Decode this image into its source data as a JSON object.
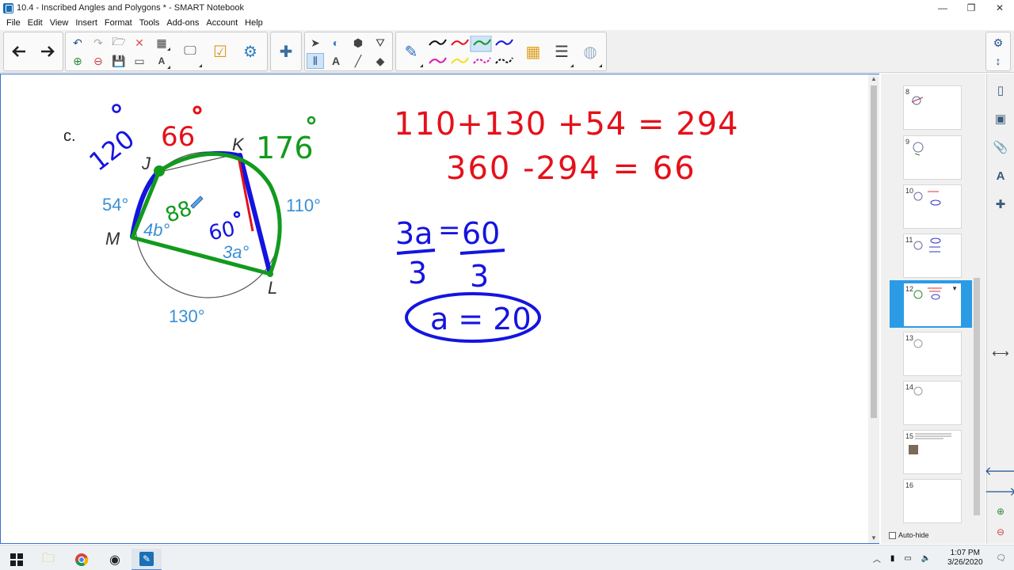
{
  "window": {
    "title": "10.4 - Inscribed Angles and Polygons * - SMART Notebook",
    "minimize": "—",
    "restore": "❐",
    "close": "✕"
  },
  "menu": [
    "File",
    "Edit",
    "View",
    "Insert",
    "Format",
    "Tools",
    "Add-ons",
    "Account",
    "Help"
  ],
  "diagram": {
    "label": "c.",
    "vertices": {
      "J": "J",
      "K": "K",
      "M": "M",
      "L": "L"
    },
    "arcs": {
      "left": "54°",
      "right": "110°",
      "bottom": "130°"
    },
    "angles": {
      "m": "4b°",
      "l": "3a°"
    },
    "handwritten": {
      "top_blue": "120",
      "top_red": "66",
      "top_green": "176",
      "inner_green": "88",
      "inner_blue": "60"
    }
  },
  "work": {
    "line1": "110+130 +54 = 294",
    "line2": "360 -294 = 66",
    "frac_left_num": "3a",
    "frac_left_den": "3",
    "equals": "=",
    "frac_right_num": "60",
    "frac_right_den": "3",
    "answer": "a = 20"
  },
  "sorter": {
    "pages": [
      "8",
      "9",
      "10",
      "11",
      "12",
      "13",
      "14",
      "15",
      "16"
    ],
    "active_page": "12",
    "autohide": "Auto-hide"
  },
  "taskbar": {
    "time": "1:07 PM",
    "date": "3/26/2020"
  },
  "colors": {
    "ink_red": "#e5101a",
    "ink_blue": "#1414e0",
    "ink_green": "#129a1d",
    "diagram_blue": "#3a8fd6",
    "sorter_active": "#2c9be6"
  }
}
